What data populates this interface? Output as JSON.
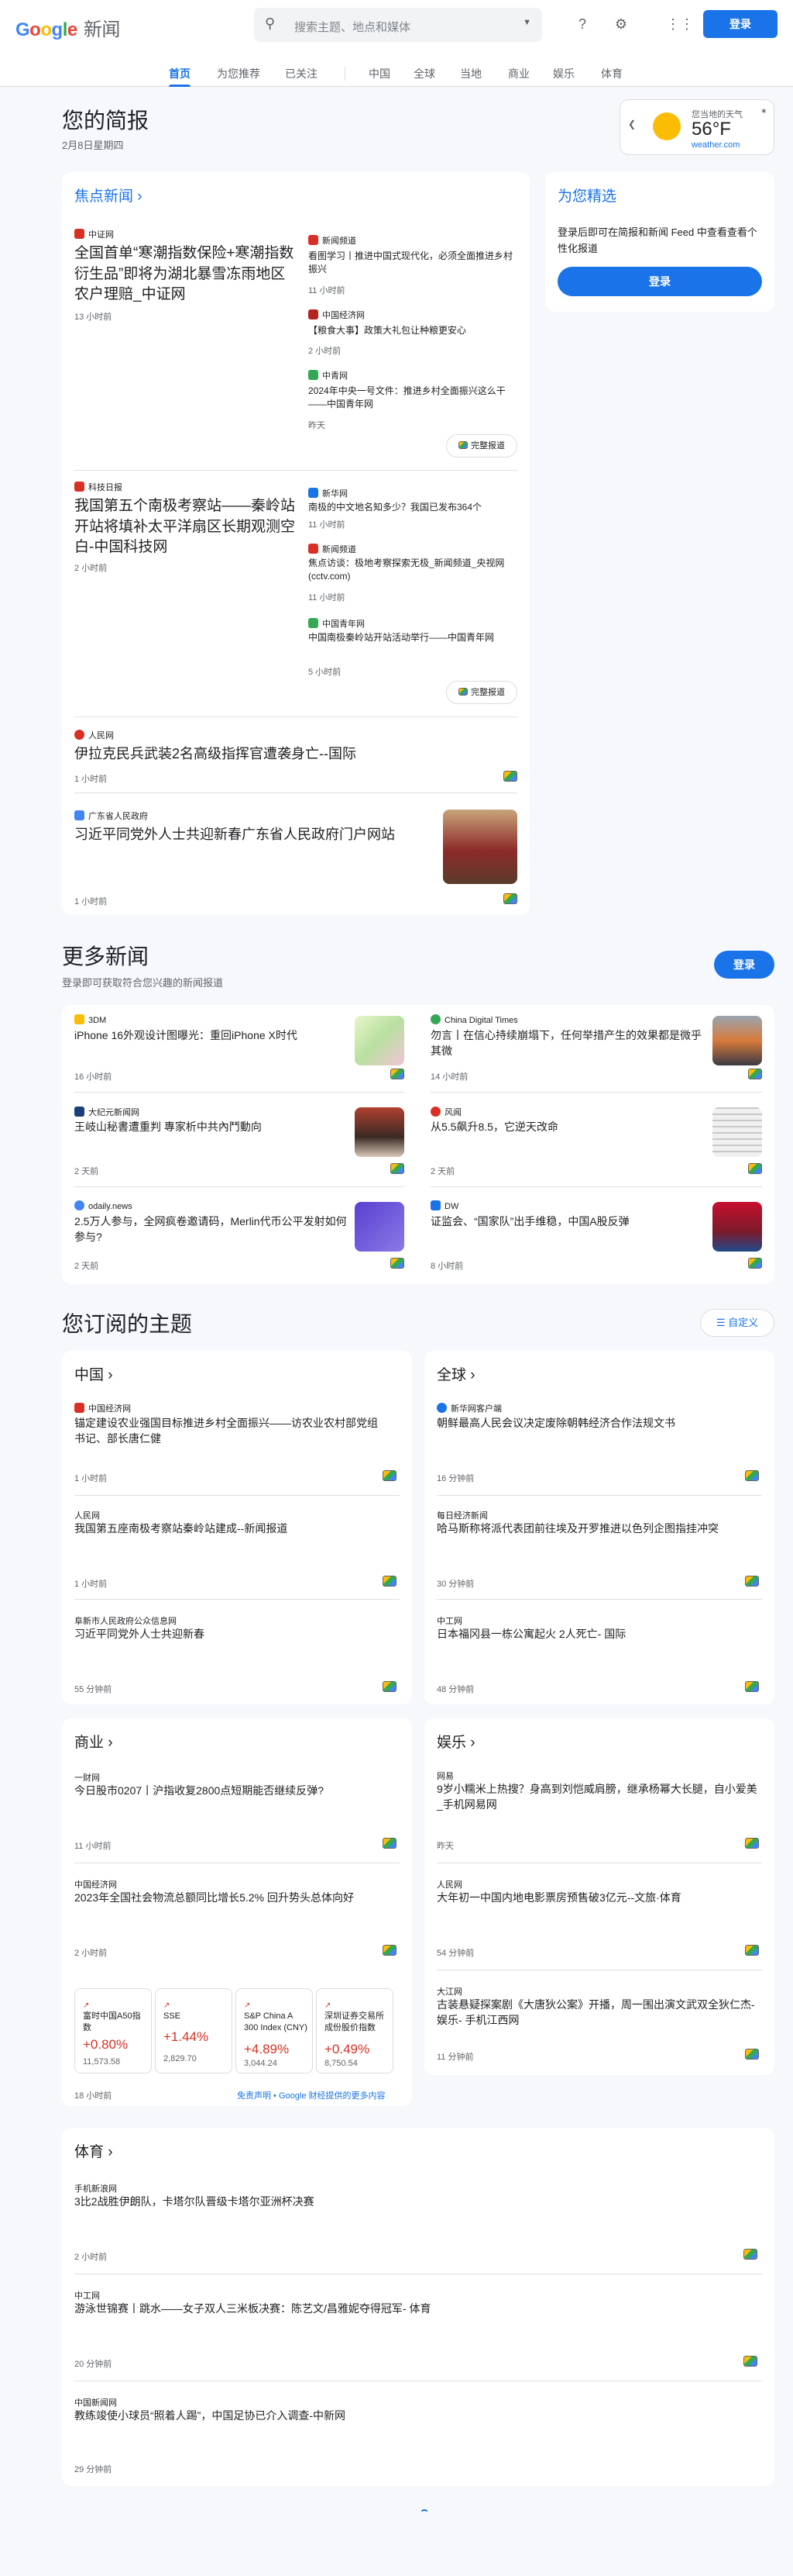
{
  "header": {
    "logo_google": "Google",
    "logo_news": "新闻",
    "search_placeholder": "搜索主题、地点和媒体",
    "signin": "登录"
  },
  "nav": [
    "首页",
    "为您推荐",
    "已关注",
    "中国",
    "全球",
    "当地",
    "商业",
    "娱乐",
    "体育"
  ],
  "briefing": {
    "title": "您的简报",
    "date": "2月8日星期四"
  },
  "weather": {
    "label": "您当地的天气",
    "temp": "56°F",
    "source": "weather.com"
  },
  "top_stories": {
    "title": "焦点新闻",
    "full_coverage": "完整报道",
    "groups": [
      {
        "main": {
          "source": "中证网",
          "title": "全国首单“寒潮指数保险+寒潮指数衍生品”即将为湖北暴雪冻雨地区农户理赔_中证网",
          "time": "13 小时前"
        },
        "side": [
          {
            "source": "新闻频道",
            "title": "看图学习丨推进中国式现代化，必须全面推进乡村振兴",
            "time": "11 小时前"
          },
          {
            "source": "中国经济网",
            "title": "【粮食大事】政策大礼包让种粮更安心",
            "time": "2 小时前"
          },
          {
            "source": "中青网",
            "title": "2024年中央一号文件：推进乡村全面振兴这么干——中国青年网",
            "time": "昨天"
          }
        ]
      },
      {
        "main": {
          "source": "科技日报",
          "title": "我国第五个南极考察站——秦岭站开站将填补太平洋扇区长期观测空白-中国科技网",
          "time": "2 小时前"
        },
        "side": [
          {
            "source": "新华网",
            "title": "南极的中文地名知多少？我国已发布364个",
            "time": "11 小时前"
          },
          {
            "source": "新闻频道",
            "title": "焦点访谈：极地考察探索无极_新闻频道_央视网(cctv.com)",
            "time": "11 小时前"
          },
          {
            "source": "中国青年网",
            "title": "中国南极秦岭站开站活动举行——中国青年网",
            "time": "5 小时前"
          }
        ]
      }
    ],
    "singles": [
      {
        "source": "人民网",
        "title": "伊拉克民兵武装2名高级指挥官遭袭身亡--国际",
        "time": "1 小时前"
      },
      {
        "source": "广东省人民政府",
        "title": "习近平同党外人士共迎新春广东省人民政府门户网站",
        "time": "1 小时前"
      }
    ]
  },
  "picks": {
    "title": "为您精选",
    "desc": "登录后即可在简报和新闻 Feed 中查看查看个性化报道",
    "signin": "登录"
  },
  "more": {
    "title": "更多新闻",
    "sub": "登录即可获取符合您兴趣的新闻报道",
    "signin": "登录",
    "items": [
      {
        "source": "3DM",
        "title": "iPhone 16外观设计图曝光：重回iPhone X时代",
        "time": "16 小时前"
      },
      {
        "source": "China Digital Times",
        "title": "勿言丨在信心持续崩塌下，任何举措产生的效果都是微乎其微",
        "time": "14 小时前"
      },
      {
        "source": "大纪元新闻网",
        "title": "王岐山秘書遭重判 專家析中共內鬥動向",
        "time": "2 天前"
      },
      {
        "source": "风闻",
        "title": "从5.5飙升8.5，它逆天改命",
        "time": "2 天前"
      },
      {
        "source": "odaily.news",
        "title": "2.5万人参与，全网疯卷邀请码，Merlin代币公平发射如何参与?",
        "time": "2 天前"
      },
      {
        "source": "DW",
        "title": "证监会、“国家队”出手维稳，中国A股反弹",
        "time": "8 小时前"
      }
    ]
  },
  "topics": {
    "title": "您订阅的主题",
    "customize": "自定义",
    "china": {
      "title": "中国",
      "items": [
        {
          "source": "中国经济网",
          "title": "锚定建设农业强国目标推进乡村全面振兴——访农业农村部党组书记、部长唐仁健",
          "time": "1 小时前"
        },
        {
          "source": "人民网",
          "title": "我国第五座南极考察站秦岭站建成--新闻报道",
          "time": "1 小时前"
        },
        {
          "source": "阜新市人民政府公众信息网",
          "title": "习近平同党外人士共迎新春",
          "time": "55 分钟前"
        }
      ]
    },
    "world": {
      "title": "全球",
      "items": [
        {
          "source": "新华网客户端",
          "title": "朝鲜最高人民会议决定废除朝韩经济合作法规文书",
          "time": "16 分钟前"
        },
        {
          "source": "每日经济新闻",
          "title": "哈马斯称将派代表团前往埃及开罗推进以色列企图指挂冲突",
          "time": "30 分钟前"
        },
        {
          "source": "中工网",
          "title": "日本福冈县一栋公寓起火 2人死亡- 国际",
          "time": "48 分钟前"
        }
      ]
    },
    "business": {
      "title": "商业",
      "items": [
        {
          "source": "一财网",
          "title": "今日股市0207丨沪指收复2800点短期能否继续反弹?",
          "time": "11 小时前"
        },
        {
          "source": "中国经济网",
          "title": "2023年全国社会物流总额同比增长5.2% 回升势头总体向好",
          "time": "2 小时前"
        }
      ],
      "stocks": [
        {
          "name": "富时中国A50指数",
          "change": "+0.80%",
          "value": "11,573.58"
        },
        {
          "name": "SSE",
          "change": "+1.44%",
          "value": "2,829.70"
        },
        {
          "name": "S&P China A 300 Index (CNY)",
          "change": "+4.89%",
          "value": "3,044.24"
        },
        {
          "name": "深圳证券交易所成份股价指数",
          "change": "+0.49%",
          "value": "8,750.54"
        }
      ],
      "stock_time": "18 小时前",
      "disclaimer": "免责声明 • Google 财经提供的更多内容"
    },
    "ent": {
      "title": "娱乐",
      "items": [
        {
          "source": "网易",
          "title": "9岁小糯米上热搜？身高到刘恺威肩膀，继承杨幂大长腿，自小爱美_手机网易网",
          "time": "昨天"
        },
        {
          "source": "人民网",
          "title": "大年初一中国内地电影票房预售破3亿元--文旅·体育",
          "time": "54 分钟前"
        },
        {
          "source": "大江网",
          "title": "古装悬疑探案剧《大唐狄公案》开播，周一围出演文武双全狄仁杰- 娱乐- 手机江西网",
          "time": "11 分钟前"
        }
      ]
    },
    "sports": {
      "title": "体育",
      "items": [
        {
          "source": "手机新浪网",
          "title": "3比2战胜伊朗队，卡塔尔队晋级卡塔尔亚洲杯决赛",
          "time": "2 小时前"
        },
        {
          "source": "中工网",
          "title": "游泳世锦赛丨跳水——女子双人三米板决赛：陈艺文/昌雅妮夺得冠军- 体育",
          "time": "20 分钟前"
        },
        {
          "source": "中国新闻网",
          "title": "教练竣使小球员“照着人踢”，中国足协已介入调查-中新网",
          "time": "29 分钟前"
        }
      ]
    }
  },
  "colors": {
    "accent": "#1a73e8",
    "up": "#d93025"
  }
}
